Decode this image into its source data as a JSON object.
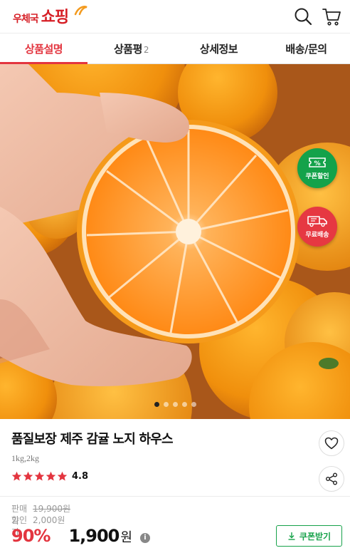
{
  "header": {
    "logo_sub": "우체국",
    "logo_main": "쇼핑",
    "search_icon": "search-icon",
    "cart_icon": "cart-icon",
    "brand_color": "#d61f26"
  },
  "tabs": [
    {
      "label": "상품설명",
      "active": true
    },
    {
      "label": "상품평",
      "count": "2",
      "active": false
    },
    {
      "label": "상세정보",
      "active": false
    },
    {
      "label": "배송/문의",
      "active": false
    }
  ],
  "hero": {
    "badges": {
      "coupon": {
        "symbol": "%",
        "label": "쿠폰할인",
        "color": "#14a24a"
      },
      "shipping": {
        "label": "무료배송",
        "color": "#e63842",
        "icon": "truck-icon"
      }
    },
    "carousel": {
      "total": 5,
      "active": 1
    }
  },
  "product": {
    "title": "품질보장 제주 감귤 노지 하우스",
    "option": "1kg,2kg",
    "rating": 4.8,
    "rating_text": "4.8",
    "stars": 5,
    "wish_icon": "heart-icon",
    "share_icon": "share-icon"
  },
  "price": {
    "sale_label": "판매가",
    "sale_value": "19,900원",
    "discount_label": "할인가",
    "discount_value": "2,000원",
    "discount_rate": "90%",
    "final_amount": "1,900",
    "final_unit": "원",
    "info_symbol": "i",
    "coupon_button": "쿠폰받기",
    "accent_color": "#e3353f"
  }
}
